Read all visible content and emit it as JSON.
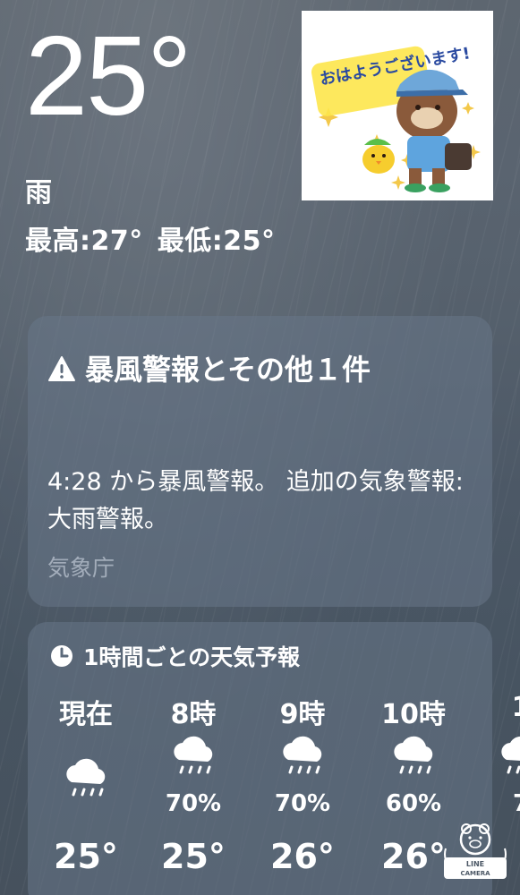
{
  "current": {
    "temperature": "25°",
    "condition": "雨",
    "high": "最高:27°",
    "low": "最低:25°"
  },
  "sticker": {
    "text": "おはようございます!"
  },
  "alert": {
    "icon": "warning-triangle-icon",
    "title": "暴風警報とその他１件",
    "body": "4:28 から暴風警報。 追加の気象警報: 大雨警報。",
    "source": "気象庁"
  },
  "hourly": {
    "icon": "clock-icon",
    "title": "1時間ごとの天気予報",
    "items": [
      {
        "time": "現在",
        "icon": "rain-cloud-icon",
        "precip": "",
        "temp": "25°"
      },
      {
        "time": "8時",
        "icon": "rain-cloud-icon",
        "precip": "70%",
        "temp": "25°"
      },
      {
        "time": "9時",
        "icon": "rain-cloud-icon",
        "precip": "70%",
        "temp": "26°"
      },
      {
        "time": "10時",
        "icon": "rain-cloud-icon",
        "precip": "60%",
        "temp": "26°"
      },
      {
        "time": "1",
        "icon": "rain-cloud-icon",
        "precip": "7",
        "temp": ""
      }
    ]
  },
  "watermark": {
    "text": "LINE CAMERA"
  }
}
